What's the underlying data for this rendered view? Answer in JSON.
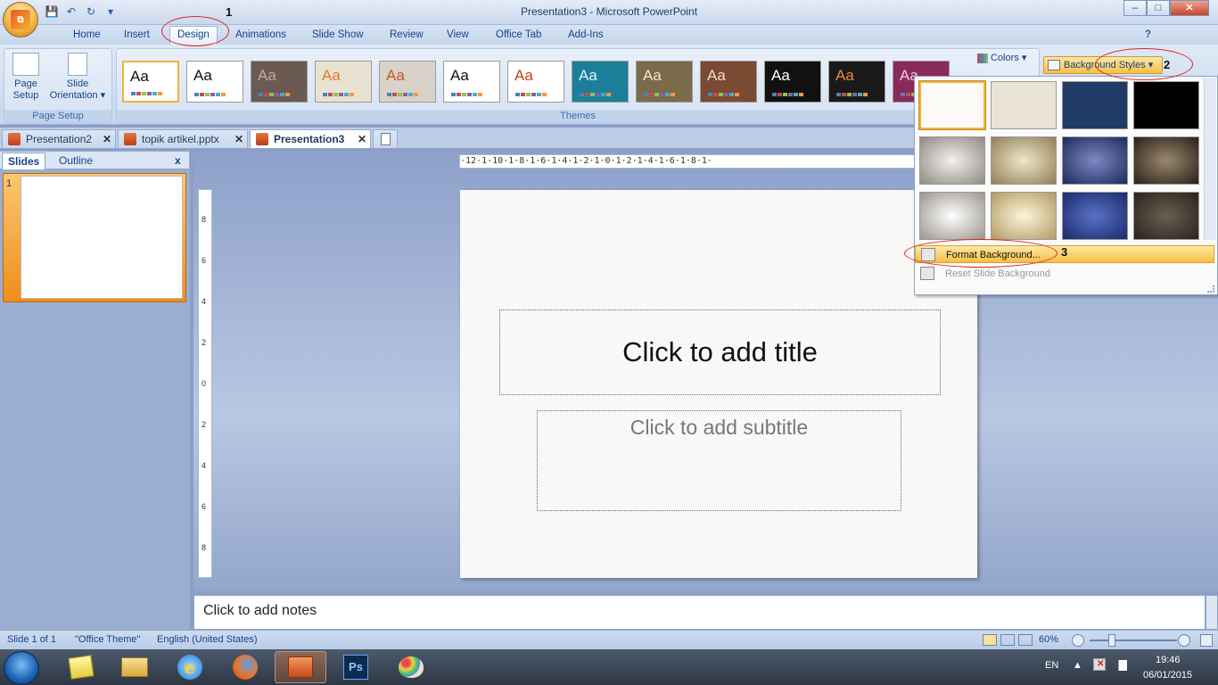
{
  "window": {
    "title": "Presentation3 - Microsoft PowerPoint",
    "minimize": "–",
    "maximize": "□",
    "close": "✕"
  },
  "qat": {
    "save": "💾",
    "undo": "↶",
    "redo": "↻",
    "more": "▾"
  },
  "ribbon_tabs": [
    "Home",
    "Insert",
    "Design",
    "Animations",
    "Slide Show",
    "Review",
    "View",
    "Office Tab",
    "Add-Ins"
  ],
  "active_tab": "Design",
  "page_setup": {
    "page_setup_label": "Page Setup",
    "page_setup_btn": "Page\nSetup",
    "orientation_btn": "Slide\nOrientation ▾"
  },
  "themes": {
    "group_label": "Themes",
    "sample": "Aa",
    "items": [
      {
        "bg": "#ffffff",
        "fg": "#111111"
      },
      {
        "bg": "#ffffff",
        "fg": "#111111"
      },
      {
        "bg": "#6b5a52",
        "fg": "#c8a898"
      },
      {
        "bg": "#e9e2d3",
        "fg": "#e07a2c"
      },
      {
        "bg": "#d8d2c8",
        "fg": "#c05a28"
      },
      {
        "bg": "#ffffff",
        "fg": "#111111"
      },
      {
        "bg": "#ffffff",
        "fg": "#c0401a"
      },
      {
        "bg": "#1c7f9a",
        "fg": "#dff4ff"
      },
      {
        "bg": "#7a6b4a",
        "fg": "#f0e8cf"
      },
      {
        "bg": "#7a4a32",
        "fg": "#f4dcc8"
      },
      {
        "bg": "#111111",
        "fg": "#ffffff"
      },
      {
        "bg": "#1a1a1a",
        "fg": "#f08a3a"
      },
      {
        "bg": "#8a2a5a",
        "fg": "#f4c8dc"
      }
    ]
  },
  "colors_btn": "Colors ▾",
  "background_styles_btn": "Background Styles ▾",
  "help_icon": "?",
  "doc_tabs": [
    {
      "label": "Presentation2",
      "close": "✕"
    },
    {
      "label": "topik artikel.pptx",
      "close": "✕"
    },
    {
      "label": "Presentation3",
      "close": "✕"
    }
  ],
  "pane": {
    "slides": "Slides",
    "outline": "Outline",
    "close": "x",
    "slide_num": "1"
  },
  "ruler": {
    "h": "·12·1·10·1·8·1·6·1·4·1·2·1·0·1·2·1·4·1·6·1·8·1·",
    "v": [
      "8",
      "6",
      "4",
      "2",
      "0",
      "2",
      "4",
      "6",
      "8"
    ]
  },
  "slide": {
    "title": "Click to add title",
    "subtitle": "Click to add subtitle"
  },
  "notes": "Click to add notes",
  "status": {
    "slide": "Slide 1 of 1",
    "theme": "\"Office Theme\"",
    "language": "English (United States)",
    "zoom": "60%"
  },
  "bg_styles": [
    {
      "c": "#fbfaf6"
    },
    {
      "c": "#e8e3d4"
    },
    {
      "c": "#1f3b66"
    },
    {
      "c": "#000000"
    },
    {
      "c": "radial-gradient(#f2f0ec,#8f8a82)"
    },
    {
      "c": "radial-gradient(#f0e7c8,#8f7f58)"
    },
    {
      "c": "radial-gradient(#7c8ac4,#1c2a5c)"
    },
    {
      "c": "radial-gradient(#9a8870,#2a2018)"
    },
    {
      "c": "radial-gradient(#ffffff,#9a958c)"
    },
    {
      "c": "radial-gradient(#fff6d8,#b09a66)"
    },
    {
      "c": "radial-gradient(#5a72c8,#1a2a6a)"
    },
    {
      "c": "radial-gradient(#6a5e50,#2a231c)"
    }
  ],
  "bg_selected_index": 0,
  "menu": {
    "format_bg": "Format Background...",
    "reset_bg": "Reset Slide Background"
  },
  "annotations": [
    "1",
    "2",
    "3"
  ],
  "taskbar": {
    "lang": "EN",
    "time": "19:46",
    "date": "06/01/2015",
    "ps_label": "Ps"
  }
}
